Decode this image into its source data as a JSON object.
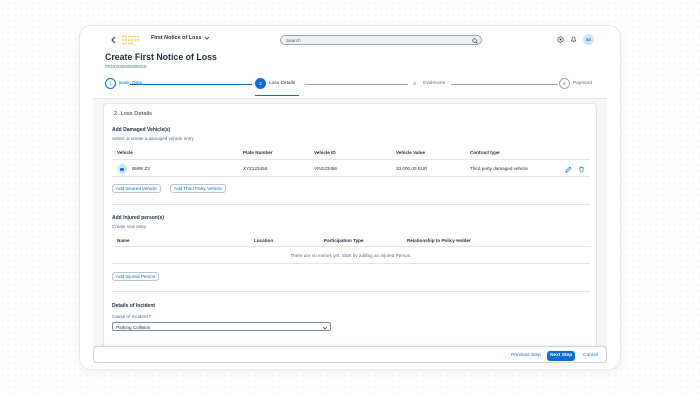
{
  "shellbar": {
    "app_title": "First Notice of Loss",
    "search_placeholder": "Search",
    "avatar_initials": "SD"
  },
  "page": {
    "title": "Create First Notice of Loss",
    "subtitle": "FNOL0000000000218"
  },
  "steps": [
    {
      "number": "1",
      "label": "Basic Data",
      "state": "completed"
    },
    {
      "number": "2",
      "label": "Loss Details",
      "state": "active"
    },
    {
      "number": "3",
      "label": "Evidences",
      "state": "upcoming"
    },
    {
      "number": "4",
      "label": "Payment",
      "state": "upcoming"
    }
  ],
  "section": {
    "title": "2. Loss Details",
    "vehicles": {
      "title": "Add Damaged Vehicle(s)",
      "subtitle": "Select or create a damaged vehicle entry",
      "columns": [
        "Vehicle",
        "Plate Number",
        "Vehicle ID",
        "Vehicle Value",
        "Contract type"
      ],
      "rows": [
        {
          "vehicle": "BMW Z3",
          "plate": "XYZ123456",
          "vehicle_id": "VIN123456",
          "value": "20,000.00 EUR",
          "contract": "Third party damaged vehicle"
        }
      ],
      "add_insured_label": "Add Insured Vehicle",
      "add_third_party_label": "Add Third Party Vehicle"
    },
    "persons": {
      "title": "Add Injured person(s)",
      "subtitle": "Create new entry",
      "columns": [
        "Name",
        "Location",
        "Participation Type",
        "Relationship to Policy Holder"
      ],
      "empty_text": "There are no entries yet. Start by adding an Injured Person.",
      "add_label": "Add Injured Person"
    },
    "incident": {
      "title": "Details of Incident",
      "cause_label": "Cause of Incident",
      "required_mark": "*",
      "cause_value": "Parking Collision"
    }
  },
  "footer": {
    "previous_label": "Previous Step",
    "next_label": "Next Step",
    "cancel_label": "Cancel"
  },
  "colors": {
    "accent": "#0a6ed1",
    "text": "#1d2d3e",
    "muted": "#556b82",
    "required": "#bb0000"
  }
}
